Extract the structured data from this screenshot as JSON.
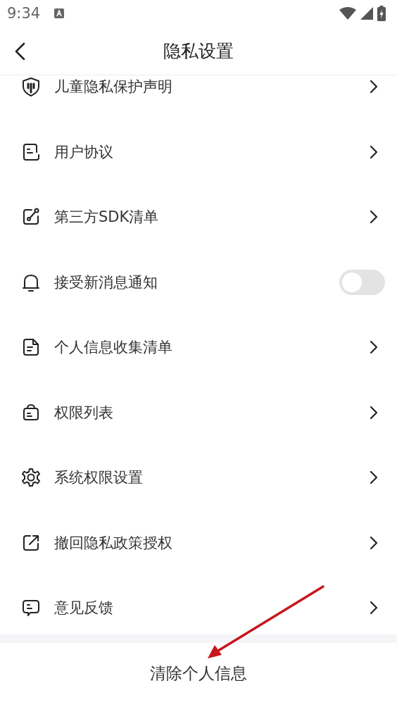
{
  "status_bar": {
    "time": "9:34"
  },
  "header": {
    "title": "隐私设置"
  },
  "items": [
    {
      "kind": "link",
      "label": "儿童隐私保护声明"
    },
    {
      "kind": "link",
      "label": "用户协议"
    },
    {
      "kind": "link",
      "label": "第三方SDK清单"
    },
    {
      "kind": "toggle",
      "label": "接受新消息通知",
      "on": false
    },
    {
      "kind": "link",
      "label": "个人信息收集清单"
    },
    {
      "kind": "link",
      "label": "权限列表"
    },
    {
      "kind": "link",
      "label": "系统权限设置"
    },
    {
      "kind": "link",
      "label": "撤回隐私政策授权"
    },
    {
      "kind": "link",
      "label": "意见反馈"
    }
  ],
  "footer_button": {
    "label": "清除个人信息"
  }
}
